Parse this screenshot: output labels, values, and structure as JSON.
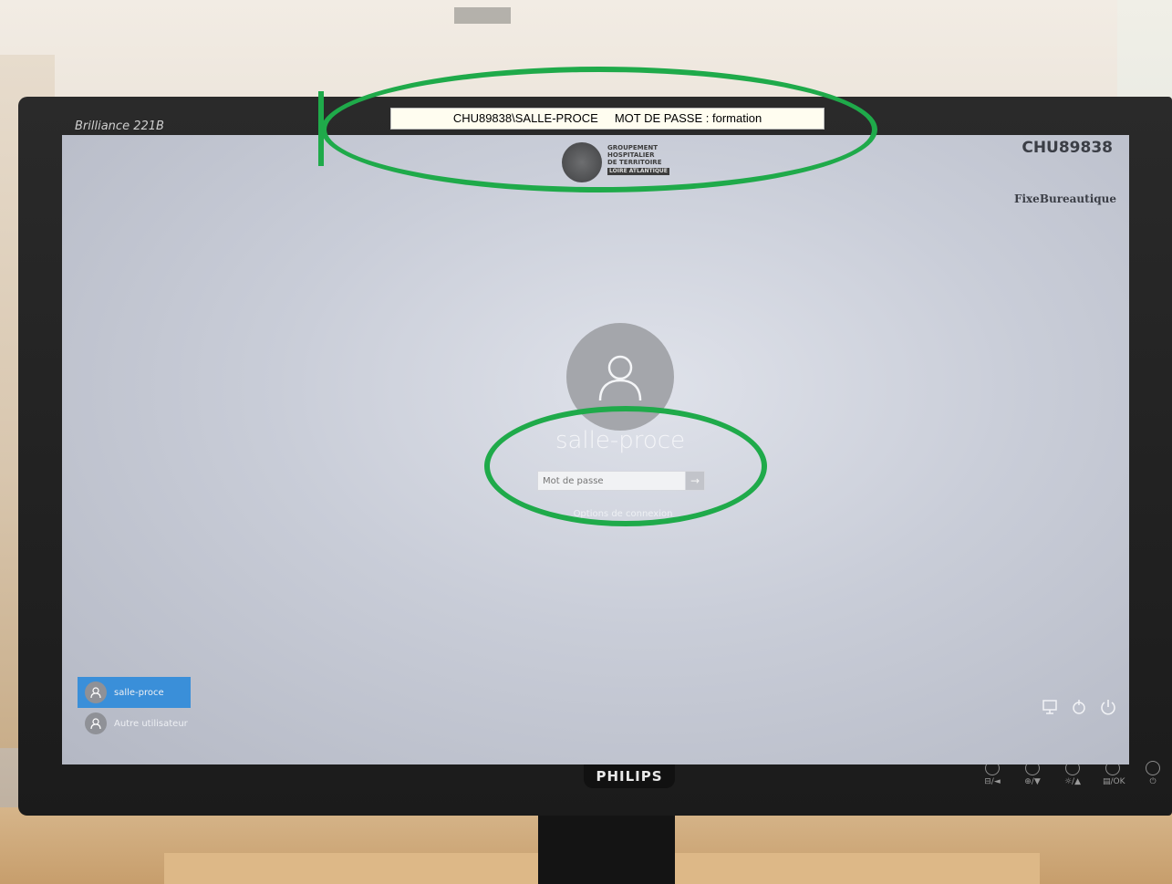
{
  "environment": {
    "monitor_model": "Brilliance 221B",
    "monitor_brand": "PHILIPS",
    "monitor_buttons": [
      "⊟/◄",
      "⊕/▼",
      "☼/▲",
      "▤/OK",
      "⏻"
    ]
  },
  "sticker": {
    "text": "CHU89838\\SALLE-PROCE     MOT DE PASSE : formation"
  },
  "login_screen": {
    "org_logo": {
      "lines": [
        "GROUPEMENT",
        "HOSPITALIER",
        "DE TERRITOIRE"
      ],
      "subline": "LOIRE ATLANTIQUE"
    },
    "machine_name": "CHU89838",
    "profile_tag": "FixeBureautique",
    "username": "salle-proce",
    "password_placeholder": "Mot de passe",
    "submit_icon": "arrow-right-icon",
    "signin_options_label": "Options de connexion",
    "users": [
      {
        "name": "salle-proce",
        "active": true
      },
      {
        "name": "Autre utilisateur",
        "active": false
      }
    ],
    "system_icons": [
      "network-icon",
      "accessibility-icon",
      "power-icon"
    ]
  },
  "colors": {
    "accent_blue": "#3a8fd9",
    "annotation_green": "#1faa4a"
  }
}
